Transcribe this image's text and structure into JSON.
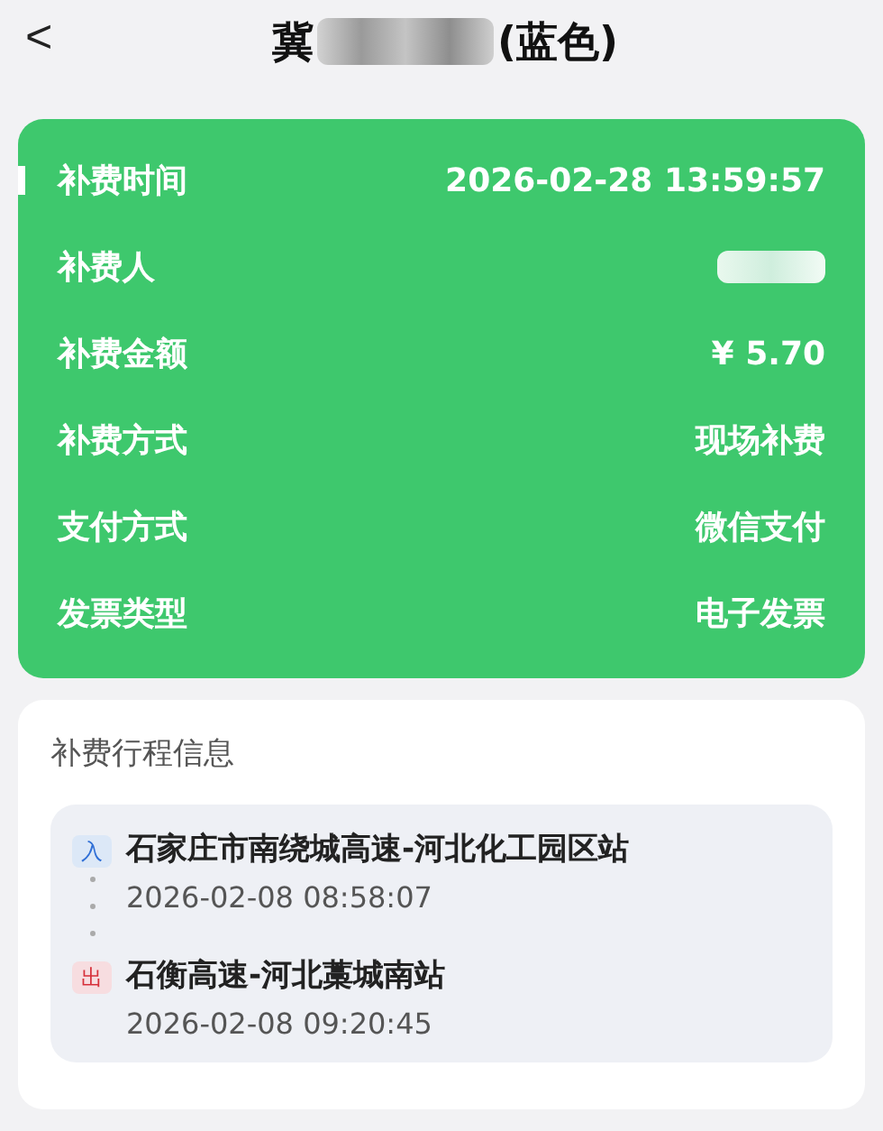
{
  "header": {
    "back": "<",
    "title_prefix": "冀",
    "title_redacted": true,
    "title_suffix": "(蓝色)"
  },
  "details": [
    {
      "label": "补费时间",
      "kind": "text",
      "value": "2026-02-28 13:59:57",
      "selected": true
    },
    {
      "label": "补费人",
      "kind": "redacted",
      "selected": false
    },
    {
      "label": "补费金额",
      "kind": "text",
      "value": "¥ 5.70",
      "selected": false
    },
    {
      "label": "补费方式",
      "kind": "text",
      "value": "现场补费",
      "selected": false
    },
    {
      "label": "支付方式",
      "kind": "text",
      "value": "微信支付",
      "selected": false
    },
    {
      "label": "发票类型",
      "kind": "text",
      "value": "电子发票",
      "selected": false
    }
  ],
  "trip": {
    "title": "补费行程信息",
    "stops": [
      {
        "kind": "entry",
        "badge": "入",
        "color": "#2f6fd6",
        "station": "石家庄市南绕城高速-河北化工园区站",
        "time": "2026-02-08 08:58:07"
      },
      {
        "kind": "exit",
        "badge": "出",
        "color": "#d6303a",
        "station": "石衡高速-河北藁城南站",
        "time": "2026-02-08 09:20:45"
      }
    ]
  }
}
